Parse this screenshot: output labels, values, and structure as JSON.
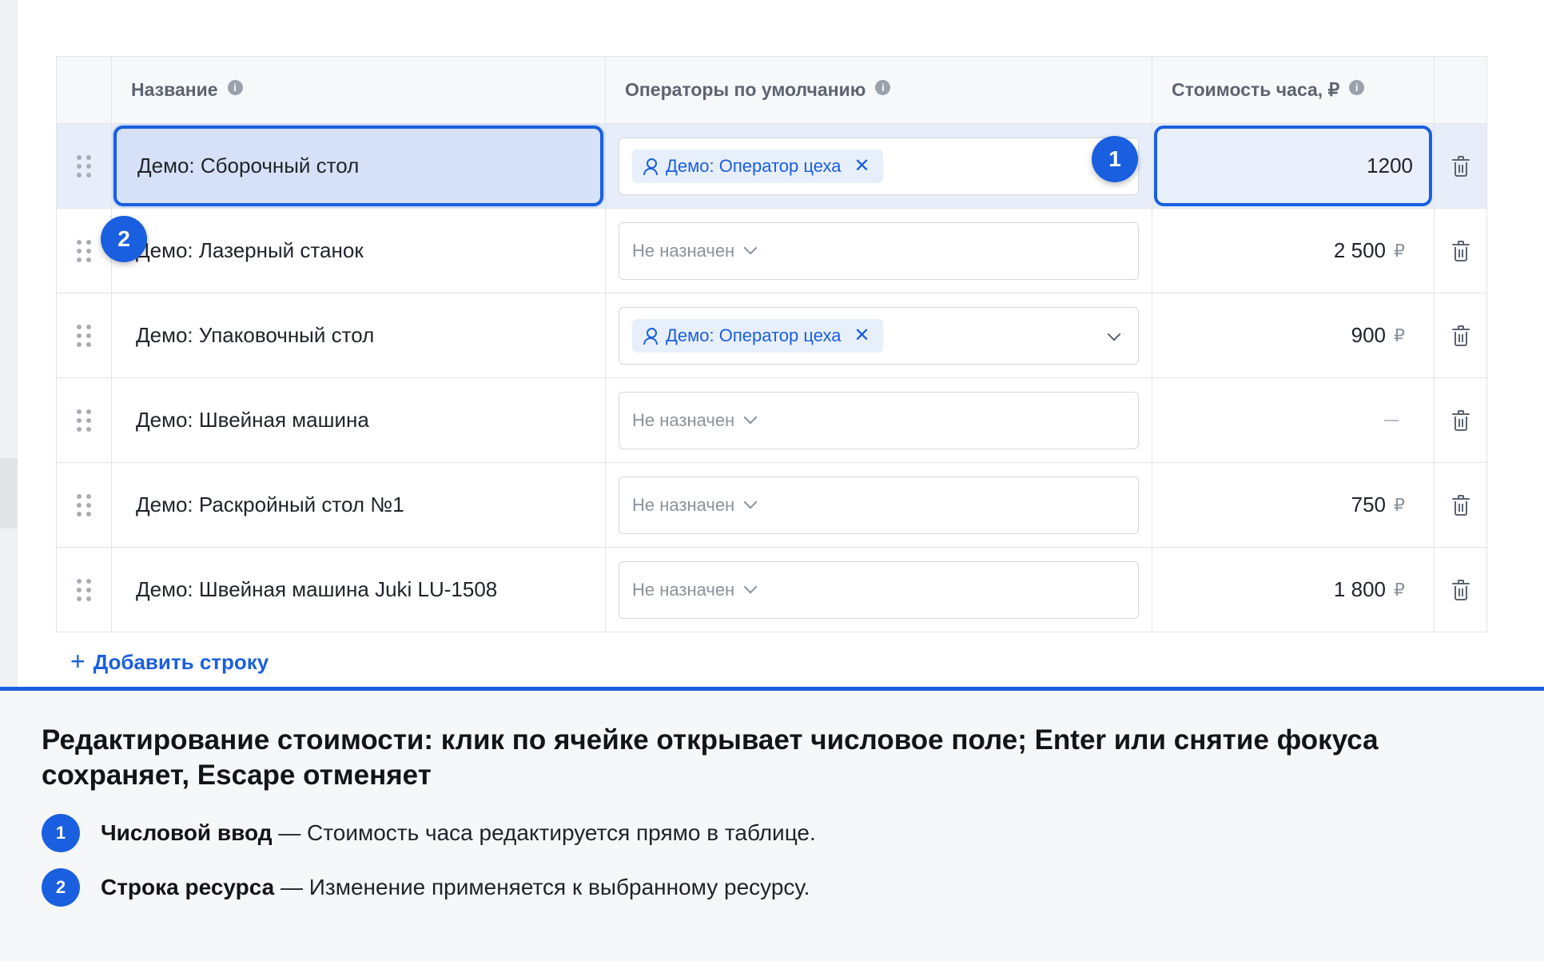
{
  "table": {
    "headers": {
      "name": "Название",
      "operators": "Операторы по умолчанию",
      "cost": "Стоимость часа, ₽"
    },
    "info_icon": "i",
    "rows": [
      {
        "name": "Демо: Сборочный стол",
        "operator_tag": "Демо: Оператор цеха",
        "cost": "1200"
      },
      {
        "name": "Демо: Лазерный станок",
        "operator_placeholder": "Не назначен",
        "cost": "2 500"
      },
      {
        "name": "Демо: Упаковочный стол",
        "operator_tag": "Демо: Оператор цеха",
        "cost": "900"
      },
      {
        "name": "Демо: Швейная машина",
        "operator_placeholder": "Не назначен",
        "cost": ""
      },
      {
        "name": "Демо: Раскройный стол №1",
        "operator_placeholder": "Не назначен",
        "cost": "750"
      },
      {
        "name": "Демо: Швейная машина Juki LU-1508",
        "operator_placeholder": "Не назначен",
        "cost": "1 800"
      }
    ],
    "currency": "₽",
    "tag_remove": "✕",
    "add_row_plus": "+",
    "add_row_label": "Добавить строку"
  },
  "markers": {
    "m1": "1",
    "m2": "2"
  },
  "footer": {
    "title": "Редактирование стоимости: клик по ячейке открывает числовое поле; Enter или снятие фокуса сохраняет, Escape отменяет",
    "legend": [
      {
        "num": "1",
        "term": "Числовой ввод",
        "desc": " — Стоимость часа редактируется прямо в таблице."
      },
      {
        "num": "2",
        "term": "Строка ресурса",
        "desc": " — Изменение применяется к выбранному ресурсу."
      }
    ]
  },
  "colors": {
    "accent": "#1a5fe0",
    "selected_row": "#e7eefa"
  }
}
